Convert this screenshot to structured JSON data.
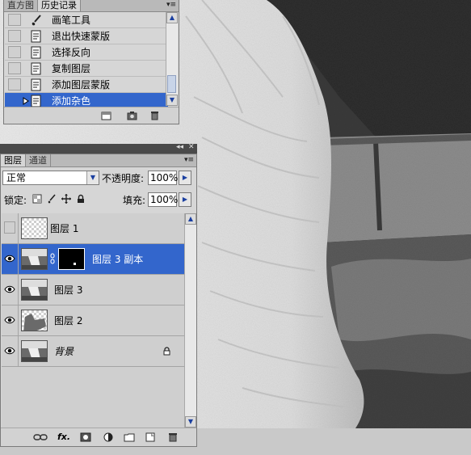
{
  "history_panel": {
    "tabs": [
      {
        "label": "直方图",
        "active": false
      },
      {
        "label": "历史记录",
        "active": true
      }
    ],
    "menu_icon": "panel-menu-icon",
    "items": [
      {
        "label": "画笔工具",
        "icon": "brush-icon",
        "selected": false
      },
      {
        "label": "退出快速蒙版",
        "icon": "history-state-icon",
        "selected": false
      },
      {
        "label": "选择反向",
        "icon": "history-state-icon",
        "selected": false
      },
      {
        "label": "复制图层",
        "icon": "history-state-icon",
        "selected": false
      },
      {
        "label": "添加图层蒙版",
        "icon": "history-state-icon",
        "selected": false
      },
      {
        "label": "添加杂色",
        "icon": "history-state-icon",
        "selected": true
      }
    ],
    "footer_icons": [
      "new-document-from-state-icon",
      "create-snapshot-icon",
      "delete-state-icon"
    ]
  },
  "layers_panel": {
    "tabs": [
      {
        "label": "图层",
        "active": true
      },
      {
        "label": "通道",
        "active": false
      }
    ],
    "collapse_icons": [
      "collapse-arrows-icon",
      "close-icon"
    ],
    "blend_mode": "正常",
    "opacity_label": "不透明度:",
    "opacity_value": "100%",
    "lock_label": "锁定:",
    "fill_label": "填充:",
    "fill_value": "100%",
    "layers": [
      {
        "name": "图层 1",
        "visible": false,
        "selected": false,
        "has_mask": false,
        "locked": false,
        "italic": false
      },
      {
        "name": "图层 3 副本",
        "visible": true,
        "selected": true,
        "has_mask": true,
        "locked": false,
        "italic": false
      },
      {
        "name": "图层 3",
        "visible": true,
        "selected": false,
        "has_mask": false,
        "locked": false,
        "italic": false
      },
      {
        "name": "图层 2",
        "visible": true,
        "selected": false,
        "has_mask": false,
        "locked": false,
        "italic": false
      },
      {
        "name": "背景",
        "visible": true,
        "selected": false,
        "has_mask": false,
        "locked": true,
        "italic": true
      }
    ],
    "footer_icons": [
      "link-layers-icon",
      "fx-icon",
      "add-mask-icon",
      "adjustment-layer-icon",
      "new-group-icon",
      "new-layer-icon",
      "delete-layer-icon"
    ],
    "fx_label": "fx."
  },
  "colors": {
    "selection": "#3366cc",
    "panel_bg": "#d6d6d6"
  }
}
